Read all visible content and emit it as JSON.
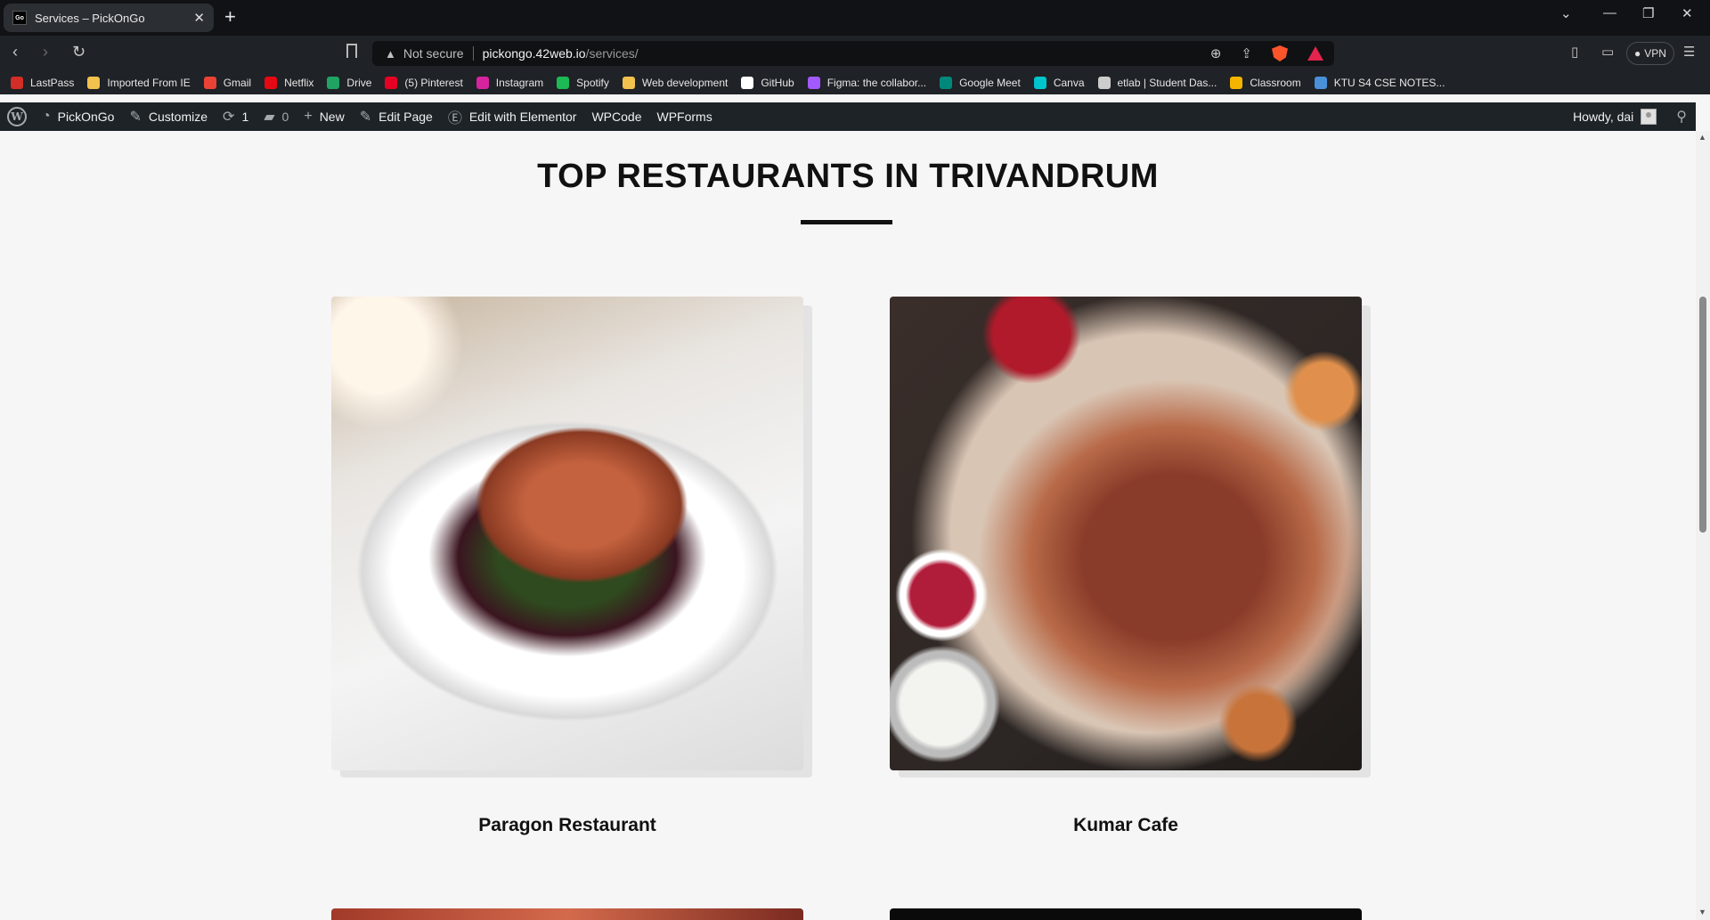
{
  "browser": {
    "tab_title": "Services – PickOnGo",
    "tab_favicon_text": "Go",
    "security_label": "Not secure",
    "url_host": "pickongo.42web.io",
    "url_path": "/services/",
    "vpn_label": "VPN"
  },
  "bookmarks": [
    {
      "label": "LastPass",
      "color": "#d32d27"
    },
    {
      "label": "Imported From IE",
      "color": "#f2c14e"
    },
    {
      "label": "Gmail",
      "color": "#ea4335"
    },
    {
      "label": "Netflix",
      "color": "#e50914"
    },
    {
      "label": "Drive",
      "color": "#1fa463"
    },
    {
      "label": "(5) Pinterest",
      "color": "#e60023"
    },
    {
      "label": "Instagram",
      "color": "#d6249f"
    },
    {
      "label": "Spotify",
      "color": "#1db954"
    },
    {
      "label": "Web development",
      "color": "#f2c14e"
    },
    {
      "label": "GitHub",
      "color": "#ffffff"
    },
    {
      "label": "Figma: the collabor...",
      "color": "#a259ff"
    },
    {
      "label": "Google Meet",
      "color": "#00897b"
    },
    {
      "label": "Canva",
      "color": "#00c4cc"
    },
    {
      "label": "etlab | Student Das...",
      "color": "#cccccc"
    },
    {
      "label": "Classroom",
      "color": "#f4b400"
    },
    {
      "label": "KTU S4 CSE NOTES...",
      "color": "#4a90d9"
    }
  ],
  "admin_bar": {
    "site_name": "PickOnGo",
    "customize": "Customize",
    "updates_count": "1",
    "comments_count": "0",
    "new": "New",
    "edit_page": "Edit Page",
    "edit_elementor": "Edit with Elementor",
    "wpcode": "WPCode",
    "wpforms": "WPForms",
    "howdy": "Howdy, dai"
  },
  "page": {
    "heading": "TOP RESTAURANTS IN TRIVANDRUM",
    "restaurants": [
      {
        "name": "Paragon Restaurant"
      },
      {
        "name": "Kumar Cafe"
      }
    ]
  }
}
